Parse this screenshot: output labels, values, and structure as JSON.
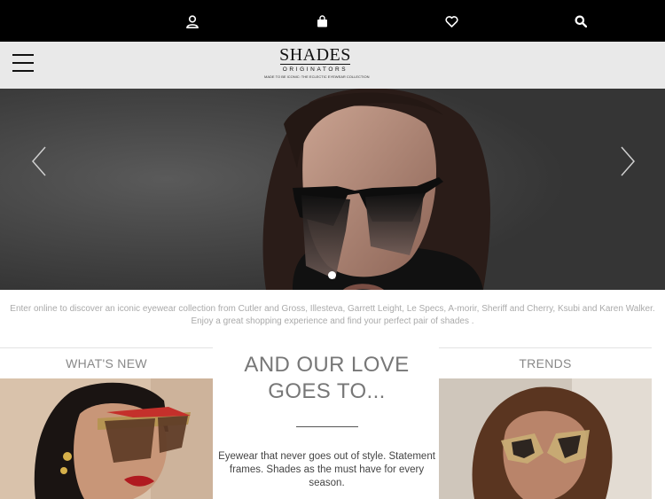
{
  "topbar": {
    "icons": [
      "user-icon",
      "shopping-bag-icon",
      "heart-icon",
      "search-icon"
    ]
  },
  "header": {
    "logo": {
      "line1": "SHADES",
      "line2": "ORIGINATORS",
      "tagline": "MADE TO BE ICONIC: THE ECLECTIC EYEWEAR COLLECTION"
    }
  },
  "hero": {
    "slide_count": 1,
    "active_slide": 1
  },
  "intro": {
    "text": "Enter online to discover an iconic eyewear collection from Cutler and Gross, Illesteva, Garrett Leight, Le Specs, A-morir, Sheriff and Cherry, Ksubi and Karen Walker. Enjoy a great shopping experience and find your perfect pair of shades ."
  },
  "sections": {
    "whats_new": {
      "title": "WHAT'S NEW"
    },
    "love": {
      "heading": "AND OUR LOVE GOES TO...",
      "text": "Eyewear that never goes out of style. Statement frames. Shades as the must have for every season."
    },
    "trends": {
      "title": "TRENDS"
    }
  },
  "colors": {
    "topbar": "#000000",
    "header": "#e9e9e9",
    "text_muted": "#888888"
  }
}
